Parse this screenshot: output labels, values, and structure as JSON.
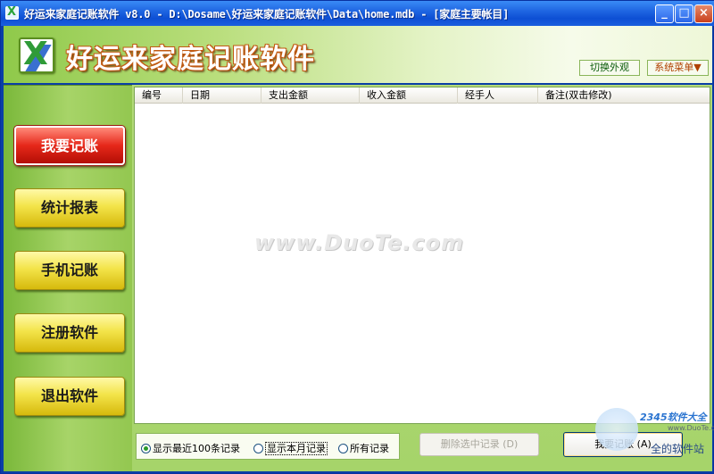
{
  "window": {
    "title": "好运来家庭记账软件 v8.0 - D:\\Dosame\\好运来家庭记账软件\\Data\\home.mdb - [家庭主要帐目]"
  },
  "header": {
    "app_title": "好运来家庭记账软件",
    "switch_skin": "切换外观",
    "system_menu": "系统菜单▼"
  },
  "sidebar": {
    "items": [
      {
        "label": "我要记账"
      },
      {
        "label": "统计报表"
      },
      {
        "label": "手机记账"
      },
      {
        "label": "注册软件"
      },
      {
        "label": "退出软件"
      }
    ]
  },
  "table": {
    "columns": [
      "编号",
      "日期",
      "支出金额",
      "收入金额",
      "经手人",
      "备注(双击修改)"
    ],
    "rows": []
  },
  "watermark": "www.DuoTe.com",
  "filters": {
    "recent_100": "显示最近100条记录",
    "this_month": "显示本月记录",
    "all": "所有记录",
    "selected": "recent_100"
  },
  "actions": {
    "delete_selected": "删除选中记录 (D)",
    "add_record": "我要记账 (A)"
  },
  "site_watermark": {
    "logo": "2345软件大全",
    "url": "www.DuoTe.com",
    "tagline": "全的软件站"
  }
}
